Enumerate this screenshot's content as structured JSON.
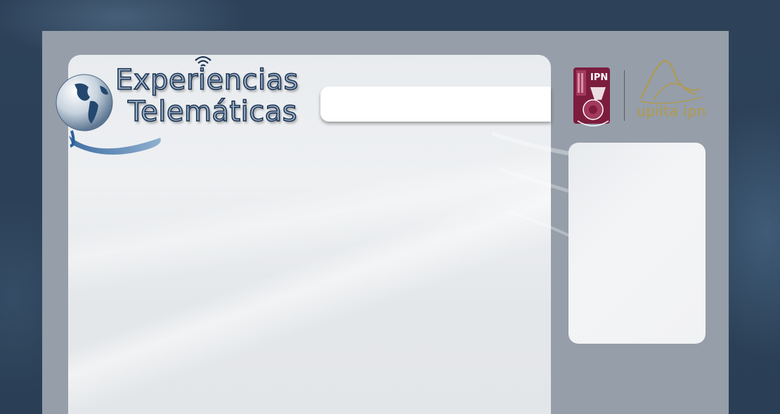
{
  "header": {
    "brand_line1": "Experiencias",
    "brand_line2": "Telemáticas",
    "logo_icon": "globe-wifi-icon"
  },
  "search": {
    "value": "",
    "placeholder": ""
  },
  "institutions": {
    "ipn_logo_icon": "ipn-shield-icon",
    "upiita_logo_icon": "upiita-logo-icon",
    "upiita_label": "upiita ipn"
  },
  "colors": {
    "page_background": "#2b4158",
    "frame": "#959ea9",
    "panel": "#e9ecef",
    "brand_text": "#9fb2c8",
    "brand_outline": "#1d3554",
    "ipn_maroon": "#7c1d3e",
    "upiita_gold": "#b39a45"
  }
}
